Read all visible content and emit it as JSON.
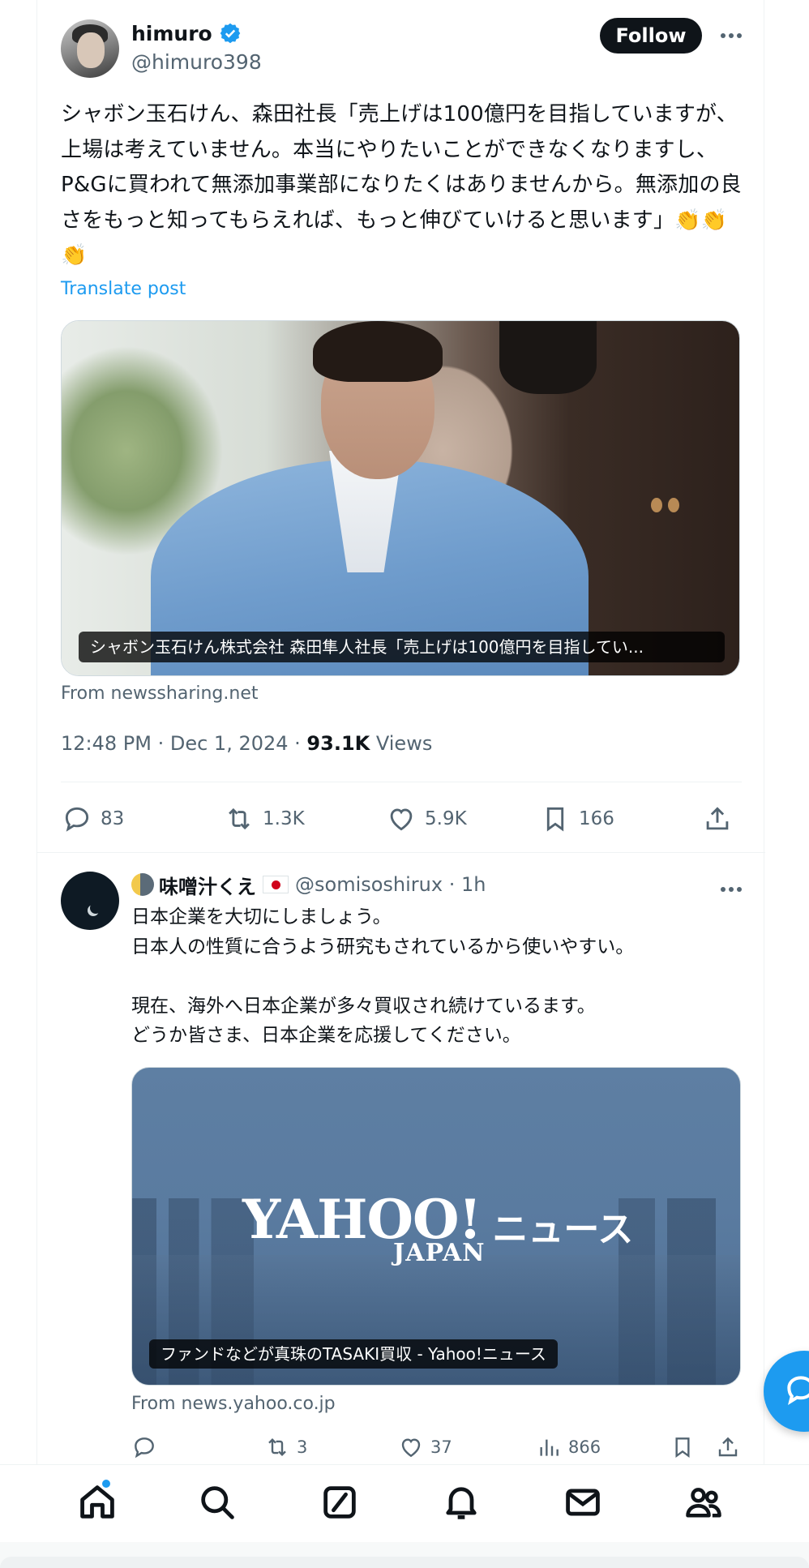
{
  "tweet": {
    "display_name": "himuro",
    "handle": "@himuro398",
    "follow_label": "Follow",
    "text": "シャボン玉石けん、森田社長「売上げは100億円を目指していますが、上場は考えていません。本当にやりたいことができなくなりますし、P&Gに買われて無添加事業部になりたくはありませんから。無添加の良さをもっと知ってもらえれば、もっと伸びていけると思います」👏👏👏",
    "translate_label": "Translate post",
    "media_caption": "シャボン玉石けん株式会社 森田隼人社長「売上げは100億円を目指してい...",
    "source": "From newssharing.net",
    "timestamp": "12:48 PM · Dec 1, 2024 · ",
    "views_count": "93.1K",
    "views_label": " Views",
    "stats": {
      "replies": "83",
      "reposts": "1.3K",
      "likes": "5.9K",
      "bookmarks": "166"
    }
  },
  "reply": {
    "display_name": "味噌汁くえ",
    "handle_time": "@somisoshirux · 1h",
    "text_lines": [
      "日本企業を大切にしましょう。",
      "日本人の性質に合うよう研究もされているから使いやすい。",
      "",
      "現在、海外へ日本企業が多々買収され続けているます。",
      "どうか皆さま、日本企業を応援してください。"
    ],
    "card_brand": "YAHOO!",
    "card_brand_sub": "JAPAN",
    "card_brand_news": "ニュース",
    "card_caption": "ファンドなどが真珠のTASAKI買収 - Yahoo!ニュース",
    "source": "From news.yahoo.co.jp",
    "stats": {
      "reposts": "3",
      "likes": "37",
      "views": "866"
    }
  },
  "colors": {
    "accent": "#1d9bf0",
    "text": "#0f1419",
    "secondary": "#536471"
  }
}
